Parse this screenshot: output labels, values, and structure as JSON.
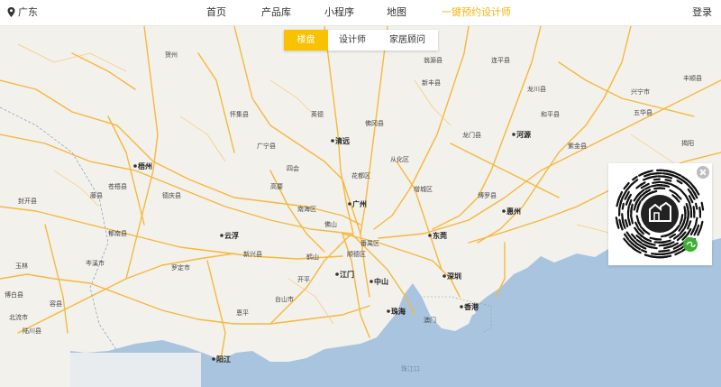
{
  "header": {
    "location": "广东",
    "nav": [
      "首页",
      "产品库",
      "小程序",
      "地图",
      "一键预约设计师"
    ],
    "login": "登录"
  },
  "tabs": [
    "楼盘",
    "设计师",
    "家居顾问"
  ],
  "colors": {
    "accent": "#f6b40e",
    "tab_active": "#f9c200",
    "sea": "#a9c4df",
    "land": "#f3f1ec",
    "road": "#f5b83d"
  },
  "icons": {
    "location": "location-pin-icon",
    "close": "close-icon",
    "miniapp": "wechat-miniprogram-icon"
  },
  "map": {
    "cities_major": [
      "梧州",
      "云浮",
      "广州",
      "东莞",
      "惠州",
      "深圳",
      "中山",
      "江门",
      "珠海",
      "香港",
      "清远",
      "河源",
      "阳江"
    ],
    "cities_minor": [
      "贺州",
      "玉林",
      "佛山",
      "从化区",
      "增城区",
      "花都区",
      "番禺区",
      "南海区",
      "博罗县",
      "龙门县",
      "新丰县",
      "紫金县",
      "揭阳",
      "五华县",
      "澳门",
      "台山市",
      "开平",
      "高要",
      "四会",
      "封开县",
      "郁南县",
      "罗定市",
      "新兴县",
      "恩平",
      "鹤山",
      "顺德区",
      "英德",
      "佛冈县",
      "翁源县",
      "连平县",
      "和平县",
      "龙川县",
      "兴宁市",
      "丰顺县",
      "藤县",
      "岑溪市",
      "苍梧县",
      "怀集县",
      "广宁县",
      "德庆县",
      "容县",
      "北流市",
      "陆川县",
      "博白县"
    ],
    "sea_label": "珠江口"
  }
}
